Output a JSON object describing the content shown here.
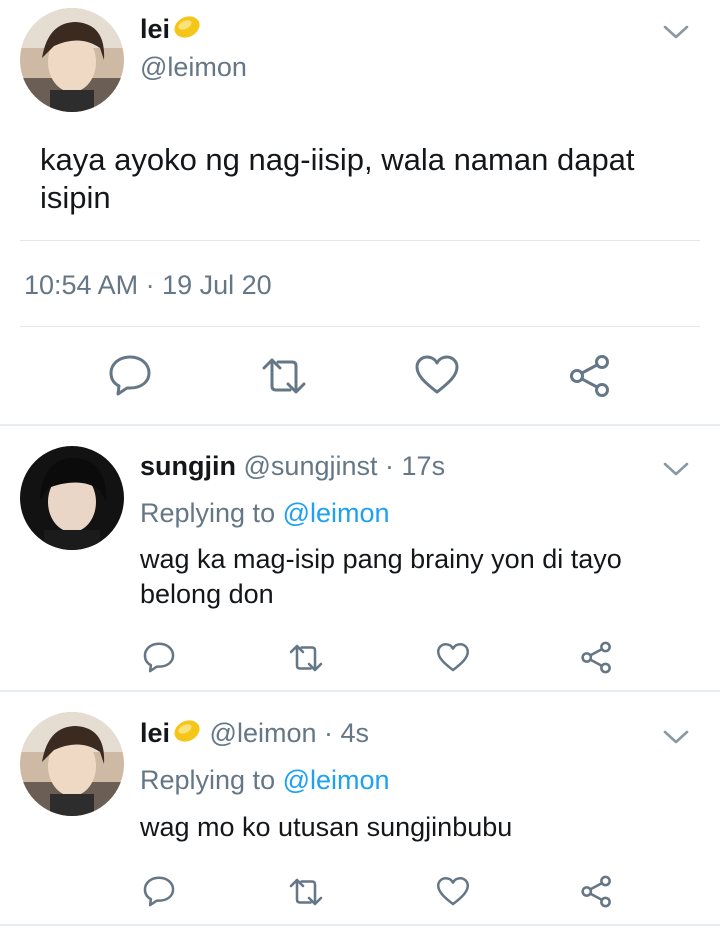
{
  "main_tweet": {
    "display_name": "lei",
    "name_emoji": "lemon-emoji",
    "handle": "@leimon",
    "text_line1": "kaya ayoko ng nag-iisip, wala naman dapat",
    "text_line2": "isipin",
    "time": "10:54 AM",
    "separator": "·",
    "date": "19 Jul 20"
  },
  "replies": [
    {
      "display_name": "sungjin",
      "handle": "@sungjinst",
      "separator": "·",
      "age": "17s",
      "replying_prefix": "Replying to",
      "replying_to": "@leimon",
      "text_line1": "wag ka mag-isip pang brainy yon di tayo",
      "text_line2": "belong don"
    },
    {
      "display_name": "lei",
      "name_emoji": "lemon-emoji",
      "handle": "@leimon",
      "separator": "·",
      "age": "4s",
      "replying_prefix": "Replying to",
      "replying_to": "@leimon",
      "text_line1": "wag mo ko utusan sungjinbubu"
    }
  ],
  "icons": {
    "reply": "reply-icon",
    "retweet": "retweet-icon",
    "like": "heart-icon",
    "share": "share-icon",
    "menu": "chevron-down-icon"
  },
  "colors": {
    "text": "#14171a",
    "secondary": "#657786",
    "link": "#1da1f2",
    "divider": "#e1e8ed",
    "lemon": "#f5c518"
  }
}
